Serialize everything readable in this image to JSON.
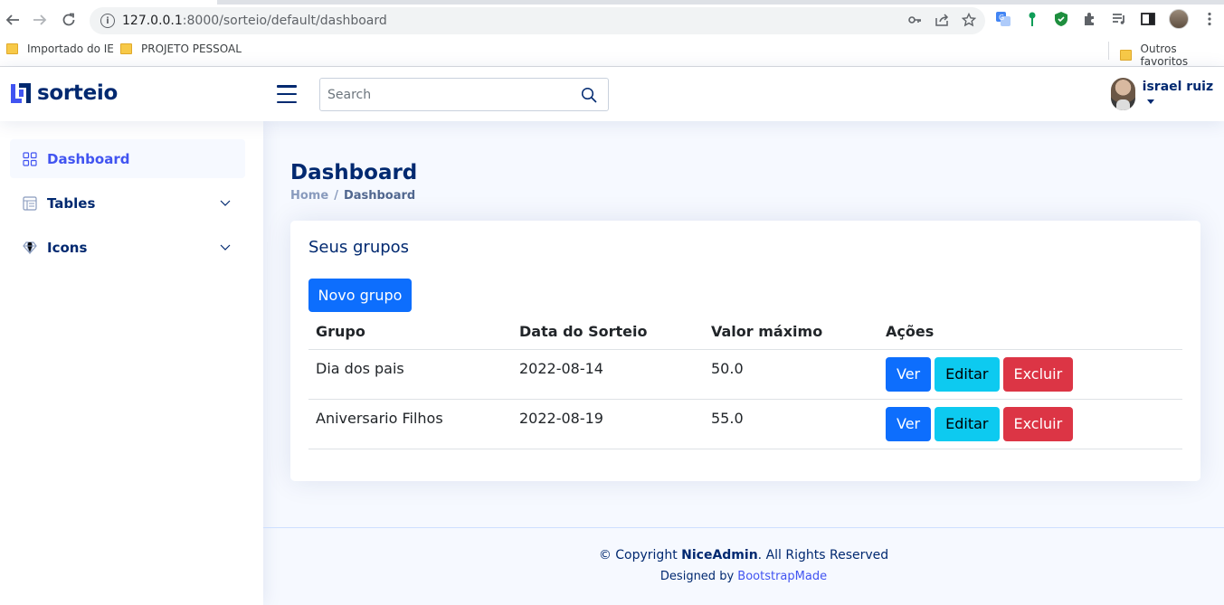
{
  "browser": {
    "url_host": "127.0.0.1",
    "url_path": ":8000/sorteio/default/dashboard",
    "bookmarks": [
      {
        "label": "Importado do IE"
      },
      {
        "label": "PROJETO PESSOAL"
      }
    ],
    "other_bookmarks": "Outros favoritos"
  },
  "header": {
    "logo_text": "sorteio",
    "search_placeholder": "Search",
    "profile_name": "israel ruiz"
  },
  "sidebar": {
    "items": [
      {
        "label": "Dashboard",
        "icon": "grid-icon",
        "active": true
      },
      {
        "label": "Tables",
        "icon": "table-icon",
        "expandable": true
      },
      {
        "label": "Icons",
        "icon": "gem-icon",
        "expandable": true
      }
    ]
  },
  "main": {
    "title": "Dashboard",
    "breadcrumb": [
      "Home",
      "Dashboard"
    ],
    "card": {
      "title": "Seus grupos",
      "new_button": "Novo grupo",
      "columns": [
        "Grupo",
        "Data do Sorteio",
        "Valor máximo",
        "Ações"
      ],
      "rows": [
        {
          "grupo": "Dia dos pais",
          "data": "2022-08-14",
          "valor": "50.0"
        },
        {
          "grupo": "Aniversario Filhos",
          "data": "2022-08-19",
          "valor": "55.0"
        }
      ],
      "actions": {
        "view": "Ver",
        "edit": "Editar",
        "delete": "Excluir"
      }
    }
  },
  "footer": {
    "copyright_prefix": "© Copyright ",
    "brand": "NiceAdmin",
    "copyright_suffix": ". All Rights Reserved",
    "designed_by": "Designed by ",
    "designer": "BootstrapMade"
  },
  "colors": {
    "primary": "#4154f1",
    "navy": "#012970",
    "btn_primary": "#0d6efd",
    "btn_info": "#0dcaf0",
    "btn_danger": "#dc3545"
  }
}
